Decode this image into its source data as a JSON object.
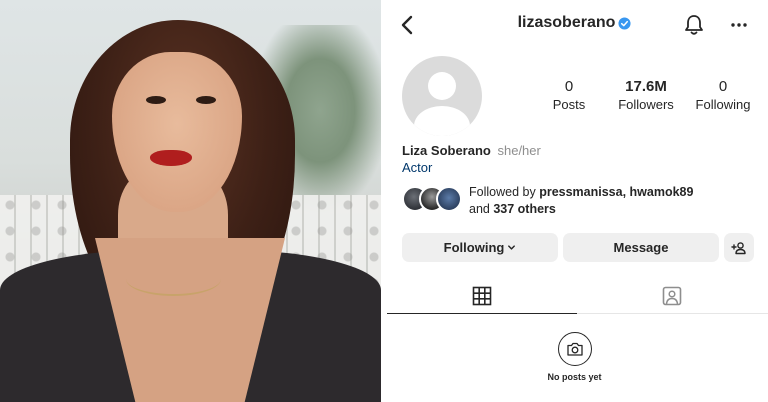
{
  "profile": {
    "username": "lizasoberano",
    "display_name": "Liza Soberano",
    "pronouns": "she/her",
    "category": "Actor",
    "stats": {
      "posts_count": "0",
      "posts_label": "Posts",
      "followers_count": "17.6M",
      "followers_label": "Followers",
      "following_count": "0",
      "following_label": "Following"
    },
    "followed_by": {
      "prefix": "Followed by ",
      "users": "pressmanissa, hwamok89",
      "and_text": "and ",
      "others": "337 others"
    }
  },
  "actions": {
    "following_label": "Following",
    "message_label": "Message"
  },
  "empty_state": {
    "text": "No posts yet"
  },
  "icons": {
    "back": "chevron-left-icon",
    "verified": "verified-badge-icon",
    "notifications": "bell-icon",
    "more": "more-horizontal-icon",
    "add_person": "add-person-icon",
    "grid_tab": "grid-icon",
    "tagged_tab": "tagged-person-icon",
    "camera": "camera-icon"
  },
  "colors": {
    "verified_blue": "#3897f0",
    "category_link": "#00376b",
    "button_bg": "#efefef",
    "lipstick": "#b01e1e"
  }
}
